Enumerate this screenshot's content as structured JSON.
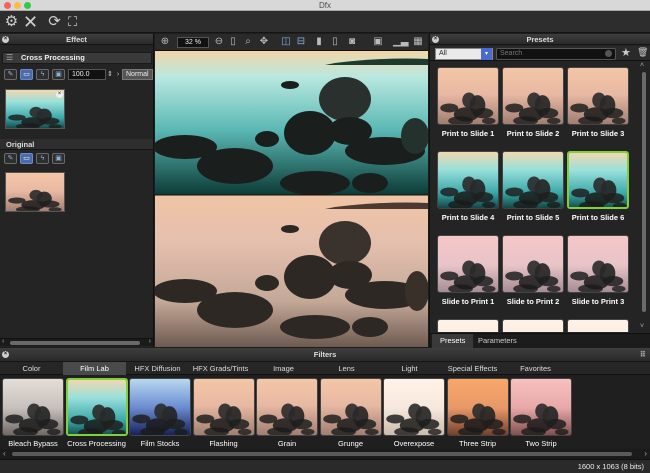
{
  "window": {
    "title": "Dfx"
  },
  "toolbar": {
    "icons": [
      "gear-icon",
      "close-icon",
      "refresh-icon",
      "crop-icon"
    ]
  },
  "effect_panel": {
    "title": "Effect",
    "filter_name": "Cross Processing",
    "opacity_value": "100.0",
    "blend_mode": "Normal",
    "original_label": "Original"
  },
  "viewer": {
    "zoom": "32 %"
  },
  "presets_panel": {
    "title": "Presets",
    "category": "All",
    "search_placeholder": "Search",
    "items": [
      {
        "label": "Print to Slide 1",
        "tone": "warm"
      },
      {
        "label": "Print to Slide 2",
        "tone": "warm"
      },
      {
        "label": "Print to Slide 3",
        "tone": "warm"
      },
      {
        "label": "Print to Slide 4",
        "tone": "cyan"
      },
      {
        "label": "Print to Slide 5",
        "tone": "cyan"
      },
      {
        "label": "Print to Slide 6",
        "tone": "cyan"
      },
      {
        "label": "Slide to Print 1",
        "tone": "pink"
      },
      {
        "label": "Slide to Print 2",
        "tone": "pink"
      },
      {
        "label": "Slide to Print 3",
        "tone": "pink"
      }
    ],
    "selected_index": 5,
    "tabs": [
      "Presets",
      "Parameters"
    ],
    "active_tab": 0
  },
  "filters_panel": {
    "title": "Filters",
    "tabs": [
      "Color",
      "Film Lab",
      "HFX Diffusion",
      "HFX Grads/Tints",
      "Image",
      "Lens",
      "Light",
      "Special Effects",
      "Favorites"
    ],
    "active_tab": 1,
    "items": [
      {
        "label": "Bleach Bypass",
        "tone": "gray"
      },
      {
        "label": "Cross Processing",
        "tone": "cyan"
      },
      {
        "label": "Film Stocks",
        "tone": "blue"
      },
      {
        "label": "Flashing",
        "tone": "warm"
      },
      {
        "label": "Grain",
        "tone": "warm"
      },
      {
        "label": "Grunge",
        "tone": "warm"
      },
      {
        "label": "Overexpose",
        "tone": "light"
      },
      {
        "label": "Three Strip",
        "tone": "orange"
      },
      {
        "label": "Two Strip",
        "tone": "pinkred"
      }
    ],
    "selected_index": 1
  },
  "status": {
    "image_info": "1600 x 1063 (8 bits)"
  },
  "colors": {
    "selection": "#7fd03a",
    "accent": "#4a6ad0",
    "background": "#1e1e1e"
  }
}
